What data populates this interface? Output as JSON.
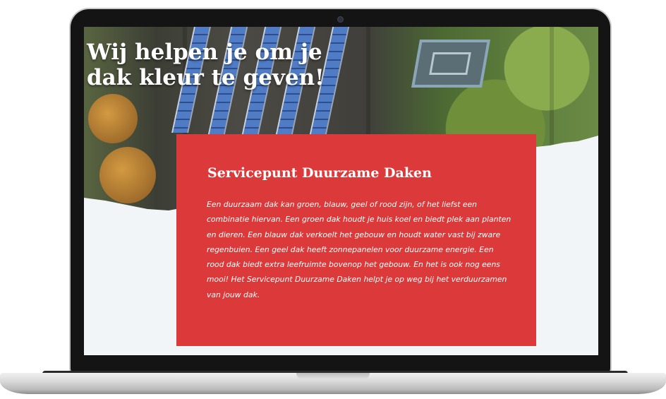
{
  "hero": {
    "title": "Wij helpen je om je dak kleur te geven!"
  },
  "card": {
    "title": "Servicepunt Duurzame Daken",
    "body": "Een duurzaam dak kan groen, blauw, geel of rood zijn, of het liefst een combinatie hiervan. Een groen dak houdt je huis koel en biedt plek aan planten en dieren. Een blauw dak verkoelt het gebouw en houdt water vast bij zware regenbuien. Een geel dak heeft zonnepanelen voor duurzame energie. Een rood dak biedt extra leefruimte bovenop het gebouw. En het is ook nog eens mooi! Het Servicepunt Duurzame Daken helpt je op weg bij het verduurzamen van jouw dak."
  },
  "colors": {
    "accent_red": "#dc3a3a",
    "page_background": "#f2f5f8",
    "text_light": "#ffffff"
  },
  "icons": {
    "camera": "webcam-icon"
  }
}
